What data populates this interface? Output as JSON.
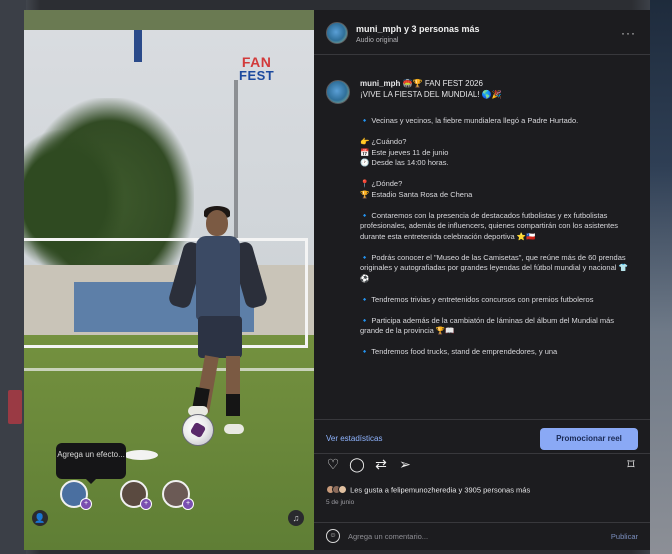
{
  "post": {
    "username_line": "muni_mph y 3 personas más",
    "audio_label": "Audio original",
    "more_label": "···"
  },
  "caption": {
    "header_user": "muni_mph",
    "header_title": "🏟️🏆 FAN FEST 2026",
    "header_subtitle": "¡VIVE LA FIESTA DEL MUNDIAL! 🌎🎉",
    "paragraphs": [
      "🔹 Vecinas y vecinos, la fiebre mundialera llegó a Padre Hurtado.",
      "👉 ¿Cuándo?\n📅 Este jueves 11 de junio\n🕐 Desde las 14:00 horas.",
      "📍 ¿Dónde?\n🏆 Estadio Santa Rosa de Chena",
      "🔹 Contaremos con la presencia de destacados futbolistas y ex futbolistas profesionales, además de influencers, quienes compartirán con los asistentes durante esta entretenida celebración deportiva ⭐🇨🇱",
      "🔹 Podrás conocer el \"Museo de las Camisetas\", que reúne más de 60 prendas originales y autografiadas por grandes leyendas del fútbol mundial y nacional 👕⚽",
      "🔹 Tendremos trivias y entretenidos concursos con premios futboleros",
      "🔹 Participa además de la cambiatón de láminas del álbum del Mundial más grande de la provincia 🏆📖",
      "🔹 Tendremos food trucks, stand de emprendedores, y una"
    ]
  },
  "media": {
    "banner_top": "FAN",
    "banner_bottom": "FEST",
    "tooltip": "Agrega un efecto...",
    "tag_badge": "+"
  },
  "actions": {
    "stats_label": "Ver estadísticas",
    "promote_label": "Promocionar reel"
  },
  "engagement": {
    "likes_text": "Les gusta a felipemunozheredia y 3905 personas más",
    "date": "5 de junio"
  },
  "comment": {
    "placeholder": "Agrega un comentario...",
    "publish_label": "Publicar"
  },
  "colors": {
    "panel_bg": "#1c1c1f",
    "link_blue": "#8fb4ff",
    "promote_bg": "#8aa9f5"
  },
  "icons": {
    "like": "heart-icon",
    "comment": "comment-icon",
    "repost": "repost-icon",
    "share": "share-icon",
    "save": "bookmark-icon"
  }
}
